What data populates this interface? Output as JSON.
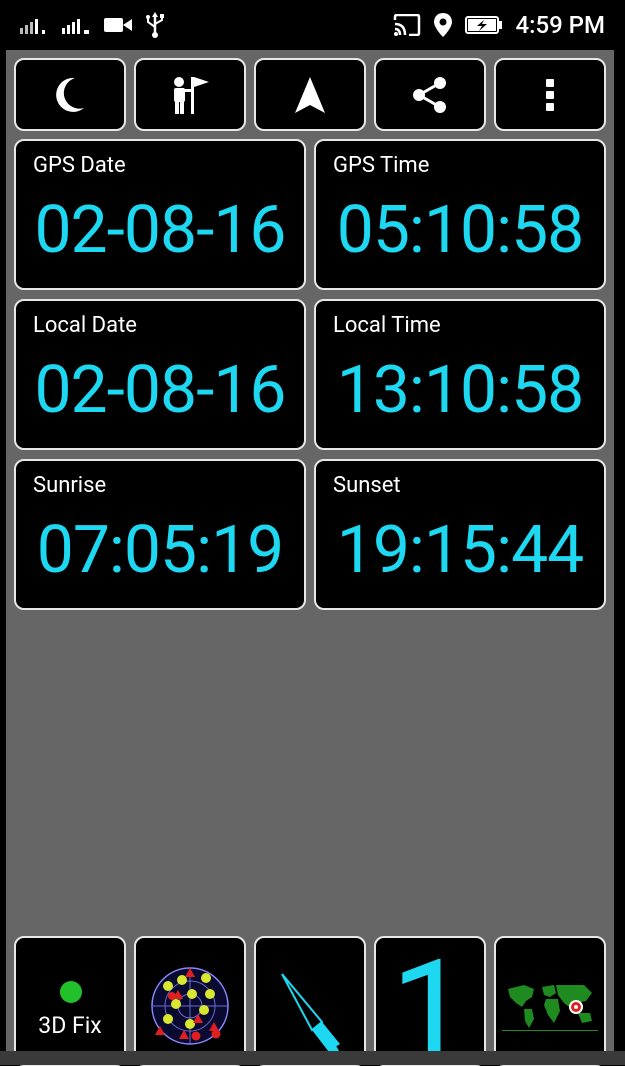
{
  "status_bar": {
    "time": "4:59 PM",
    "icons": [
      "signal-1-icon",
      "signal-2-icon",
      "video-camera-icon",
      "usb-icon",
      "cast-icon",
      "location-pin-icon",
      "battery-charging-icon"
    ]
  },
  "toolbar": {
    "buttons": [
      {
        "name": "night-mode-button",
        "icon": "moon-icon"
      },
      {
        "name": "waypoint-button",
        "icon": "person-flag-icon"
      },
      {
        "name": "navigation-button",
        "icon": "navigation-arrow-icon"
      },
      {
        "name": "share-button",
        "icon": "share-icon"
      },
      {
        "name": "more-options-button",
        "icon": "more-vert-icon"
      }
    ]
  },
  "cards": {
    "gps_date": {
      "label": "GPS Date",
      "value": "02-08-16"
    },
    "gps_time": {
      "label": "GPS Time",
      "value": "05:10:58"
    },
    "local_date": {
      "label": "Local Date",
      "value": "02-08-16"
    },
    "local_time": {
      "label": "Local Time",
      "value": "13:10:58"
    },
    "sunrise": {
      "label": "Sunrise",
      "value": "07:05:19"
    },
    "sunset": {
      "label": "Sunset",
      "value": "19:15:44"
    }
  },
  "bottom_bar": {
    "fix_status": "3D Fix",
    "fix_color": "#22c02a",
    "counter": "1",
    "icons": [
      "satellite-skyplot-icon",
      "compass-icon",
      "world-map-icon"
    ]
  },
  "colors": {
    "accent": "#1ed7f0",
    "background": "#666666",
    "card": "#000000",
    "border": "#e8e8e8"
  }
}
